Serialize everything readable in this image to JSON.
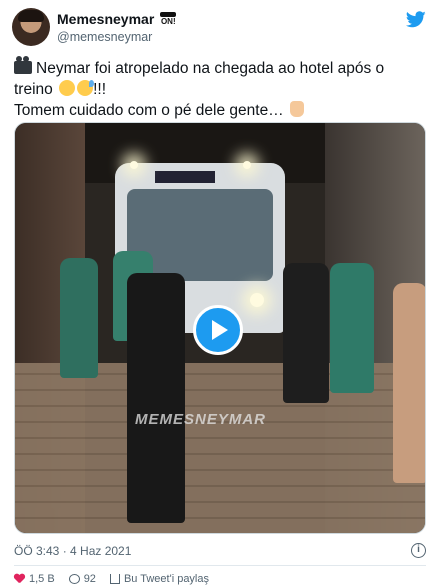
{
  "header": {
    "display_name": "Memesneymar",
    "badge_text": "ON!",
    "handle": "@memesneymar"
  },
  "tweet": {
    "line1": "Neymar foi atropelado na chegada ao hotel após o",
    "line2": "treino",
    "line2_suffix": "!!!",
    "line3": "Tomem cuidado com o pé dele gente…",
    "icons": [
      "film-camera-emoji",
      "rolling-eyes-emoji",
      "sweat-smile-emoji",
      "folded-hands-emoji"
    ]
  },
  "video": {
    "watermark": "MEMESNEYMAR"
  },
  "footer": {
    "timestamp": "ÖÖ 3:43 · 4 Haz 2021",
    "likes": "1,5 B",
    "replies": "92",
    "share_label": "Bu Tweet'i paylaş"
  },
  "colors": {
    "accent": "#1d9bf0",
    "text": "#0f1419",
    "secondary": "#536471",
    "like": "#e0245e"
  }
}
